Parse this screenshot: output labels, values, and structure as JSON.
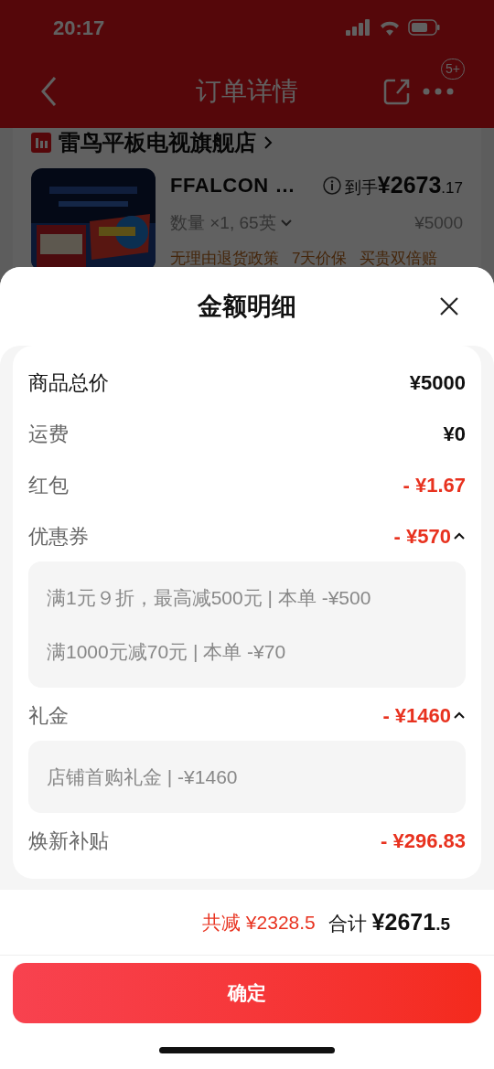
{
  "status_bar": {
    "time": "20:17"
  },
  "header": {
    "title": "订单详情",
    "badge": "5+"
  },
  "store": {
    "name": "雷鸟平板电视旗舰店"
  },
  "product": {
    "name": "FFALCON …",
    "price_label": "到手",
    "price_integer": "¥2673",
    "price_decimal": ".17",
    "quantity": "数量 ×1, 65英",
    "original_price": "¥5000",
    "tags": [
      "无理由退货政策",
      "7天价保",
      "买贵双倍赔"
    ]
  },
  "sheet": {
    "title": "金额明细",
    "rows": [
      {
        "kind": "total",
        "label": "商品总价",
        "amount": "¥5000"
      },
      {
        "kind": "fee",
        "label": "运费",
        "amount": "¥0"
      },
      {
        "kind": "discount",
        "label": "红包",
        "amount": "- ¥1.67"
      },
      {
        "kind": "discount",
        "label": "优惠券",
        "amount": "- ¥570",
        "expanded": true,
        "details": [
          "满1元９折，最高减500元 | 本单 -¥500",
          "满1000元减70元 | 本单 -¥70"
        ]
      },
      {
        "kind": "discount",
        "label": "礼金",
        "amount": "- ¥1460",
        "expanded": true,
        "details": [
          "店铺首购礼金 | -¥1460"
        ]
      },
      {
        "kind": "discount",
        "label": "焕新补贴",
        "amount": "- ¥296.83"
      }
    ],
    "footer": {
      "saved": "共减 ¥2328.5",
      "total_label": "合计",
      "total_integer": "¥2671",
      "total_decimal": ".5"
    },
    "confirm": "确定"
  }
}
